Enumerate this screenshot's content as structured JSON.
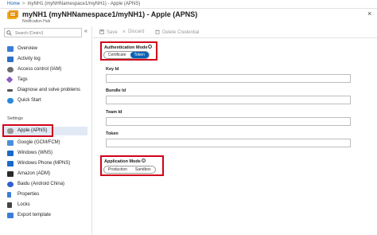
{
  "breadcrumb": {
    "home": "Home",
    "sep": ">",
    "current": "myNH1 (myNHNamespace1/myNH1) - Apple (APNS)"
  },
  "header": {
    "title": "myNH1 (myNHNamespace1/myNH1) - Apple (APNS)",
    "subtitle": "Notification Hub",
    "close": "×"
  },
  "sidebar": {
    "search_placeholder": "Search (Cmd+/)",
    "collapse": "«",
    "items": [
      {
        "label": "Overview",
        "icon": "overview-icon",
        "color": "#3b7dd8"
      },
      {
        "label": "Activity log",
        "icon": "activity-log-icon",
        "color": "#2f6fc4"
      },
      {
        "label": "Access control (IAM)",
        "icon": "access-control-icon",
        "color": "#6b6b6b"
      },
      {
        "label": "Tags",
        "icon": "tag-icon",
        "color": "#8a5ec2"
      },
      {
        "label": "Diagnose and solve problems",
        "icon": "wrench-icon",
        "color": "#555555"
      },
      {
        "label": "Quick Start",
        "icon": "cloud-icon",
        "color": "#2b88d8"
      }
    ],
    "settings_label": "Settings",
    "settings_items": [
      {
        "label": "Apple (APNS)",
        "icon": "apple-icon",
        "color": "#999999"
      },
      {
        "label": "Google (GCM/FCM)",
        "icon": "google-icon",
        "color": "#4a90d9"
      },
      {
        "label": "Windows (WNS)",
        "icon": "windows-icon",
        "color": "#1b6ac9"
      },
      {
        "label": "Windows Phone (MPNS)",
        "icon": "windows-phone-icon",
        "color": "#1b6ac9"
      },
      {
        "label": "Amazon (ADM)",
        "icon": "amazon-icon",
        "color": "#2b2b2b"
      },
      {
        "label": "Baidu (Android China)",
        "icon": "baidu-icon",
        "color": "#2f5fd0"
      },
      {
        "label": "Properties",
        "icon": "properties-icon",
        "color": "#3b7dd8"
      },
      {
        "label": "Locks",
        "icon": "lock-icon",
        "color": "#444444"
      },
      {
        "label": "Export template",
        "icon": "export-template-icon",
        "color": "#3b7dd8"
      }
    ]
  },
  "toolbar": {
    "save": "Save",
    "discard": "Discard",
    "delete": "Delete Credential"
  },
  "form": {
    "auth_mode_label": "Authentication Mode",
    "auth_options": [
      "Certificate",
      "Token"
    ],
    "auth_selected": "Token",
    "key_id_label": "Key Id",
    "bundle_id_label": "Bundle Id",
    "team_id_label": "Team Id",
    "token_label": "Token",
    "app_mode_label": "Application Mode",
    "app_options": [
      "Production",
      "Sandbox"
    ],
    "info": "i"
  },
  "colors": {
    "accent": "#0a62b8",
    "highlight": "#d0021b"
  }
}
